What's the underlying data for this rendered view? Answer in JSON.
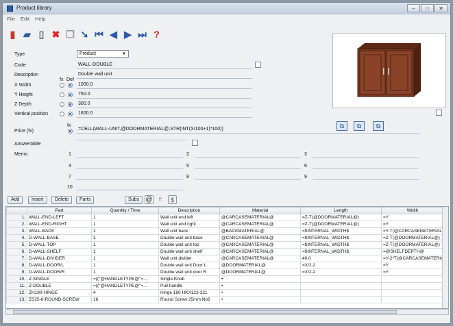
{
  "window": {
    "title": "Product library"
  },
  "menu": [
    "File",
    "Edit",
    "Help"
  ],
  "toolbar_icons": [
    "save-icon",
    "open-icon",
    "new-icon",
    "delete-icon",
    "copy-icon",
    "import-icon",
    "first-icon",
    "prev-icon",
    "next-icon",
    "last-icon",
    "help-icon"
  ],
  "form": {
    "type_label": "Type",
    "type_value": "Product",
    "code_label": "Code",
    "code_value": "WALL-DOUBLE",
    "desc_label": "Description",
    "desc_value": "Double wall unit",
    "fx_label": "fx",
    "def_label": "Def",
    "xwidth_label": "X Width",
    "xwidth_value": "1000.0",
    "yheight_label": "Y Height",
    "yheight_value": "750.0",
    "zdepth_label": "Z Depth",
    "zdepth_value": "300.0",
    "vpos_label": "Vertical position",
    "vpos_value": "1600.0",
    "price_label": "Price (fx)",
    "price_value": "=CELL(WALL-UNIT,@DOORMATERIAL@,STR(INT(X/100+1)*100))",
    "answertable_label": "Answertable",
    "memo_label": "Memo"
  },
  "memo_numbers": [
    "1",
    "2",
    "3",
    "4",
    "5",
    "6",
    "7",
    "8",
    "9",
    "10"
  ],
  "buttons": {
    "add": "Add",
    "insert": "Insert",
    "delete": "Delete",
    "parts": "Parts",
    "subs": "Subs"
  },
  "table": {
    "headers": [
      "Part",
      "Quantity / Time",
      "Description",
      "Material",
      "Length",
      "Width"
    ],
    "rows": [
      [
        "1.",
        "WALL-END-LEFT",
        "1",
        "Wall unit end left",
        "@CARCASEMATERIAL@",
        "=Z-T(@DOORMATERIAL@)",
        "=Y"
      ],
      [
        "2.",
        "WALL-END-RIGHT",
        "1",
        "Wall unit end right",
        "@CARCASEMATERIAL@",
        "=Z-T(@DOORMATERIAL@)",
        "=Y"
      ],
      [
        "3.",
        "WALL-BACK",
        "1",
        "Wall unit back",
        "@BACKMATERIAL@",
        "=$INTERNAL_WIDTH$",
        "=Y-T(@CARCASEMATERIAL@)+16"
      ],
      [
        "4.",
        "D-WALL-BASE",
        "1",
        "Double wall unit base",
        "@CARCASEMATERIAL@",
        "=$INTERNAL_WIDTH$",
        "=Z-T(@DOORMATERIAL@)"
      ],
      [
        "5.",
        "D-WALL-TOP",
        "1",
        "Double wall unit top",
        "@CARCASEMATERIAL@",
        "=$INTERNAL_WIDTH$",
        "=Z-T(@DOORMATERIAL@)"
      ],
      [
        "6.",
        "D-WALL-SHELF",
        "1",
        "Double wall unit shelf",
        "@CARCASEMATERIAL@",
        "=$INTERNAL_WIDTH$",
        "=@SHELFDEPTH@"
      ],
      [
        "7.",
        "D-WALL-DIVIDER",
        "1",
        "Wall unit divider",
        "@CARCASEMATERIAL@",
        "40.0",
        "=Y-2*T(@CARCASEMATERIAL@)"
      ],
      [
        "8.",
        "D-WALL-DOOR/L",
        "1",
        "Double wall unit Door L",
        "@DOORMATERIAL@",
        "=X/2-2",
        "=Y"
      ],
      [
        "9.",
        "D-WALL-DOOR/R",
        "1",
        "Double wall unit door R",
        "@DOORMATERIAL@",
        "=X/2-2",
        "=Y"
      ],
      [
        "10.",
        "Z-SINGLE",
        "=((\"@HANDLETYPE@\"=...",
        "Single Knob",
        "•",
        "",
        ""
      ],
      [
        "11.",
        "Z-DOUBLE",
        "=((\"@HANDLETYPE@\"=...",
        "Pull handle",
        "•",
        "",
        ""
      ],
      [
        "12.",
        "ZH180-HINGE",
        "4",
        "Hinge 180 HKX123-321",
        "•",
        "",
        ""
      ],
      [
        "13.",
        "ZS25-6-ROUND-SCREW",
        "16",
        "Round Screw 25mm No6",
        "•",
        "",
        ""
      ]
    ]
  },
  "colors": {
    "cabinet": "#7a3a24",
    "cabinet_dark": "#4e2212",
    "handle": "#c9ccd0"
  }
}
